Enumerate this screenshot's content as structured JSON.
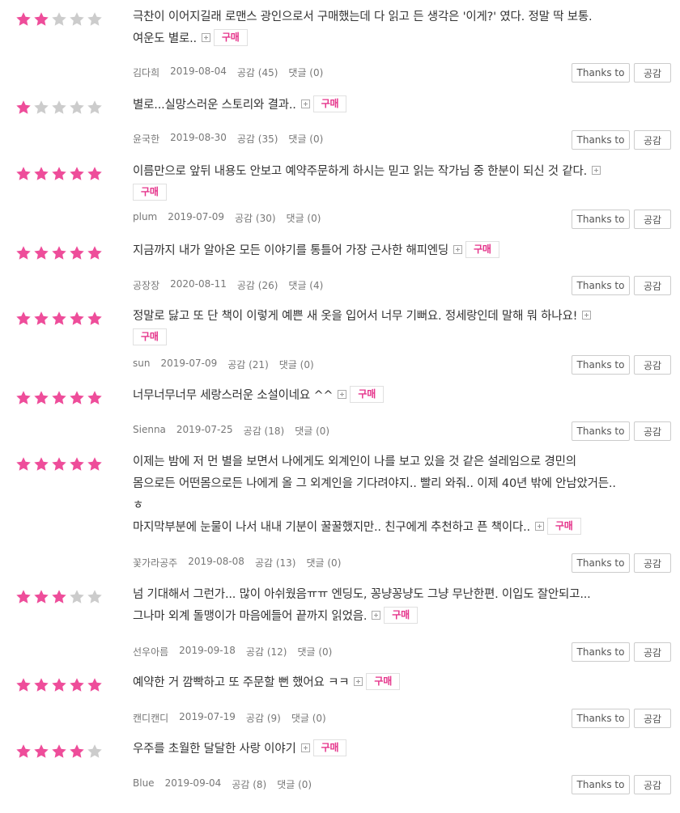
{
  "colors": {
    "star_on": "#EE4D9A",
    "star_off": "#CCCCCC",
    "badge_text": "#E5348B"
  },
  "icons": {
    "star": "star-icon",
    "more": "plus-box-icon"
  },
  "buttons": {
    "thanks": "Thanks to",
    "like": "공감"
  },
  "badge_label": "구매",
  "reviews": [
    {
      "rating": 2,
      "lines": [
        "극찬이 이어지길래 로맨스 광인으로서 구매했는데 다 읽고 든 생각은 '이게?' 였다. 정말 딱 보통.",
        "여운도 별로.."
      ],
      "author": "김다희",
      "date": "2019-08-04",
      "likes": "공감 (45)",
      "comments": "댓글 (0)"
    },
    {
      "rating": 1,
      "lines": [
        "별로...실망스러운 스토리와 결과.."
      ],
      "author": "윤국한",
      "date": "2019-08-30",
      "likes": "공감 (35)",
      "comments": "댓글 (0)"
    },
    {
      "rating": 5,
      "lines": [
        "이름만으로 앞뒤 내용도 안보고 예약주문하게 하시는 믿고 읽는 작가님 중 한분이 되신 것 같다."
      ],
      "author": "plum",
      "date": "2019-07-09",
      "likes": "공감 (30)",
      "comments": "댓글 (0)"
    },
    {
      "rating": 5,
      "lines": [
        "지금까지 내가 알아온 모든 이야기를 통틀어 가장 근사한 해피엔딩"
      ],
      "author": "공장장",
      "date": "2020-08-11",
      "likes": "공감 (26)",
      "comments": "댓글 (4)"
    },
    {
      "rating": 5,
      "lines": [
        "정말로 닳고 또 단 책이 이렇게 예쁜 새 옷을 입어서 너무 기뻐요. 정세랑인데 말해 뭐 하나요!"
      ],
      "author": "sun",
      "date": "2019-07-09",
      "likes": "공감 (21)",
      "comments": "댓글 (0)"
    },
    {
      "rating": 5,
      "lines": [
        "너무너무너무 세랑스러운 소설이네요 ^^"
      ],
      "author": "Sienna",
      "date": "2019-07-25",
      "likes": "공감 (18)",
      "comments": "댓글 (0)"
    },
    {
      "rating": 5,
      "lines": [
        "이제는 밤에 저 먼 별을 보면서 나에게도 외계인이 나를 보고 있을 것 같은 설레임으로 경민의",
        "몸으로든 어떤몸으로든 나에게 올 그 외계인을 기다려야지.. 빨리 와줘.. 이제 40년 밖에 안남았거든..",
        "ㅎ",
        "마지막부분에 눈물이 나서 내내 기분이 꿀꿀했지만.. 친구에게 추천하고 픈 책이다.."
      ],
      "author": "꽃가라공주",
      "date": "2019-08-08",
      "likes": "공감 (13)",
      "comments": "댓글 (0)"
    },
    {
      "rating": 3,
      "lines": [
        "넘 기대해서 그런가... 많이 아쉬웠음ㅠㅠ 엔딩도, 꽁냥꽁냥도 그냥 무난한편. 이입도 잘안되고...",
        "그나마 외계 돌맹이가 마음에들어 끝까지 읽었음."
      ],
      "author": "선우아름",
      "date": "2019-09-18",
      "likes": "공감 (12)",
      "comments": "댓글 (0)"
    },
    {
      "rating": 5,
      "lines": [
        "예약한 거 깜빡하고 또 주문할 뻔 했어요 ㅋㅋ"
      ],
      "author": "캔디캔디",
      "date": "2019-07-19",
      "likes": "공감 (9)",
      "comments": "댓글 (0)"
    },
    {
      "rating": 4,
      "lines": [
        "우주를 초월한 달달한 사랑 이야기"
      ],
      "author": "Blue",
      "date": "2019-09-04",
      "likes": "공감 (8)",
      "comments": "댓글 (0)"
    }
  ]
}
